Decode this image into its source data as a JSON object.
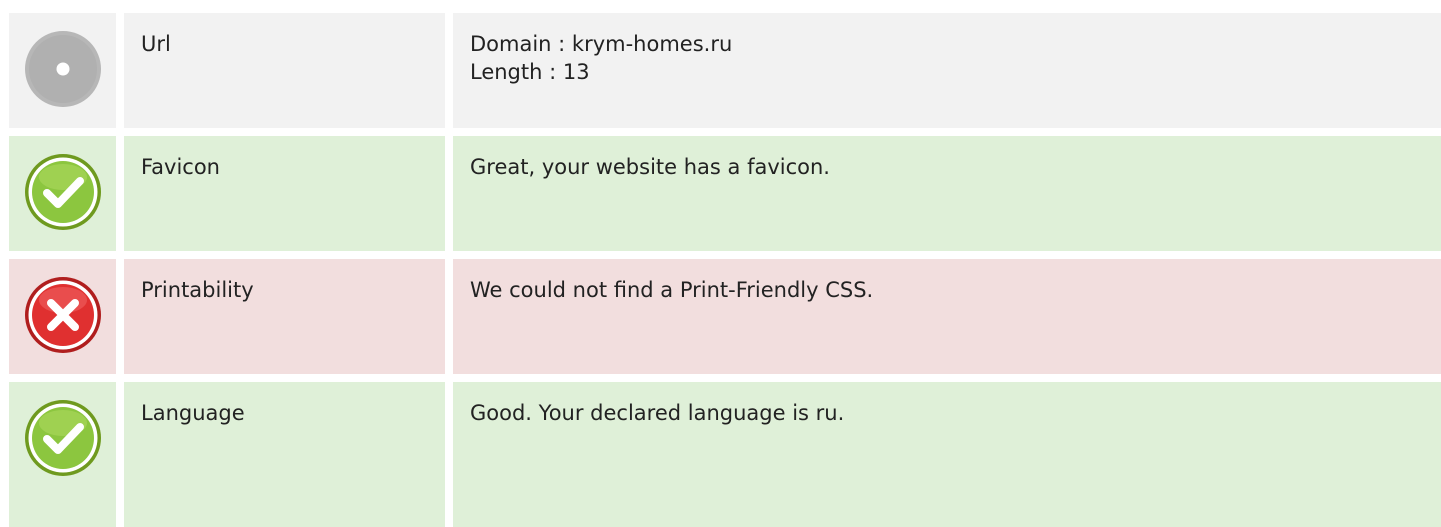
{
  "colors": {
    "neutral_bg": "#f2f2f2",
    "pass_bg": "#dff0d8",
    "fail_bg": "#f2dede",
    "neutral_icon": "#b3b3b3",
    "pass_icon": "#8cc63f",
    "fail_icon": "#e03030"
  },
  "rows": [
    {
      "status": "neutral",
      "icon": "info-circle-icon",
      "label": "Url",
      "lines": [
        "Domain : krym-homes.ru",
        "Length : 13"
      ]
    },
    {
      "status": "pass",
      "icon": "check-circle-icon",
      "label": "Favicon",
      "lines": [
        "Great, your website has a favicon."
      ]
    },
    {
      "status": "fail",
      "icon": "cross-circle-icon",
      "label": "Printability",
      "lines": [
        "We could not find a Print-Friendly CSS."
      ]
    },
    {
      "status": "pass",
      "icon": "check-circle-icon",
      "label": "Language",
      "lines": [
        "Good. Your declared language is ru."
      ]
    }
  ]
}
